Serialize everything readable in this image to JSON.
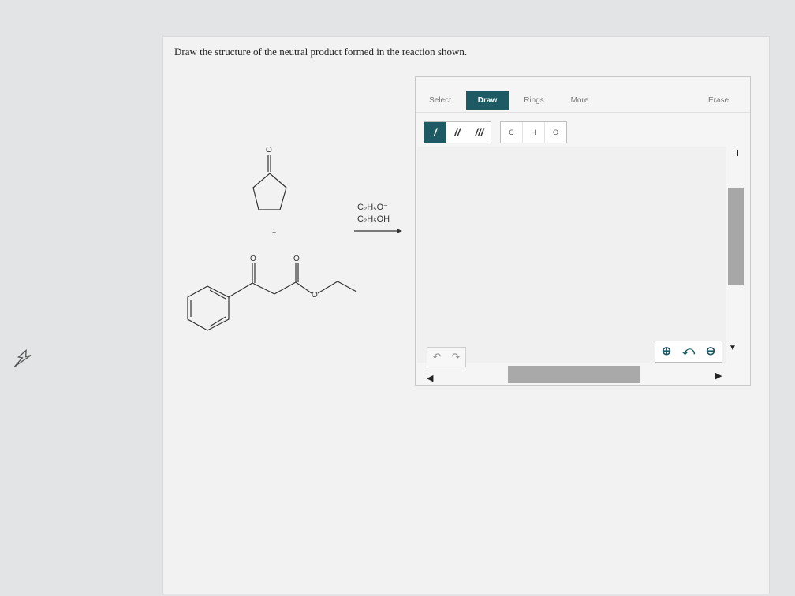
{
  "question": {
    "prompt": "Draw the structure of the neutral product formed in the reaction shown."
  },
  "reaction": {
    "reagent_line1": "C₂H₅O⁻",
    "reagent_line2": "C₂H₅OH",
    "plus_sign": "+",
    "reactant1_label": "O",
    "reactant2_labels": [
      "O",
      "O",
      "O"
    ]
  },
  "editor": {
    "tabs": [
      {
        "label": "Select",
        "active": false
      },
      {
        "label": "Draw",
        "active": true
      },
      {
        "label": "Rings",
        "active": false
      },
      {
        "label": "More",
        "active": false
      },
      {
        "label": "Erase",
        "active": false
      }
    ],
    "bond_buttons": [
      {
        "label": "/",
        "selected": true
      },
      {
        "label": "//",
        "selected": false
      },
      {
        "label": "///",
        "selected": false
      }
    ],
    "atom_buttons": [
      "C",
      "H",
      "O"
    ],
    "undo_icon": "undo-icon",
    "redo_icon": "redo-icon",
    "zoom_in_icon": "zoom-in-icon",
    "zoom_reset_icon": "zoom-reset-icon",
    "zoom_out_icon": "zoom-out-icon",
    "accent_color": "#1e5a64"
  }
}
